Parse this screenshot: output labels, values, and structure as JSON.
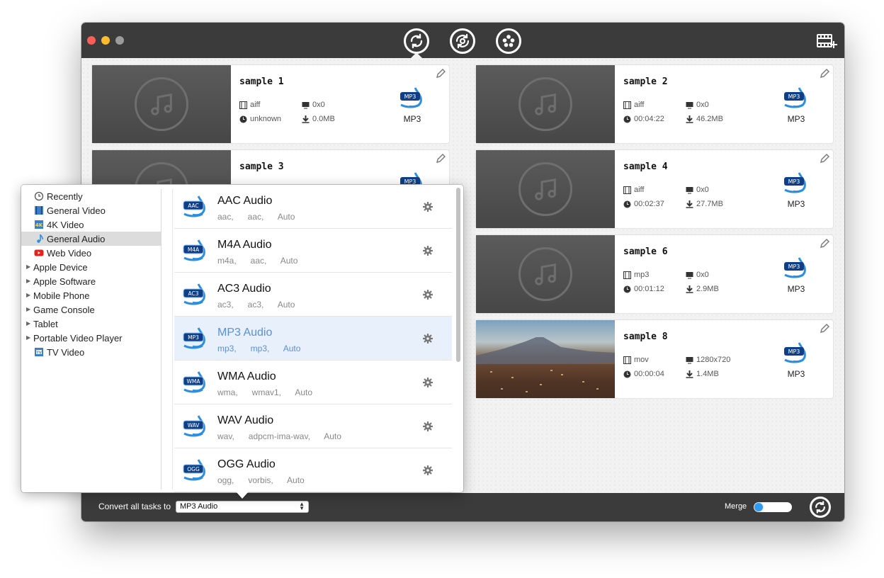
{
  "toolbar": {
    "convert_icon": "convert-icon",
    "rip_icon": "rip-icon",
    "toolbox_icon": "film-reel-icon",
    "add_files_icon": "add-video-icon"
  },
  "cards": [
    {
      "title": "sample 1",
      "format": "aiff",
      "resolution": "0x0",
      "duration": "unknown",
      "size": "0.0MB",
      "output": "MP3"
    },
    {
      "title": "sample 2",
      "format": "aiff",
      "resolution": "0x0",
      "duration": "00:04:22",
      "size": "46.2MB",
      "output": "MP3"
    },
    {
      "title": "sample 3",
      "format": "",
      "resolution": "",
      "duration": "",
      "size": "",
      "output": ""
    },
    {
      "title": "sample 4",
      "format": "aiff",
      "resolution": "0x0",
      "duration": "00:02:37",
      "size": "27.7MB",
      "output": "MP3"
    },
    {
      "title": "sample 6",
      "format": "mp3",
      "resolution": "0x0",
      "duration": "00:01:12",
      "size": "2.9MB",
      "output": "MP3"
    },
    {
      "title": "sample 8",
      "format": "mov",
      "resolution": "1280x720",
      "duration": "00:00:04",
      "size": "1.4MB",
      "output": "MP3"
    }
  ],
  "categories": [
    {
      "label": "Recently",
      "icon": "history-icon"
    },
    {
      "label": "General Video",
      "icon": "film-icon"
    },
    {
      "label": "4K Video",
      "icon": "4k-icon"
    },
    {
      "label": "General Audio",
      "icon": "music-note-icon"
    },
    {
      "label": "Web Video",
      "icon": "youtube-icon"
    },
    {
      "label": "Apple Device"
    },
    {
      "label": "Apple Software"
    },
    {
      "label": "Mobile Phone"
    },
    {
      "label": "Game Console"
    },
    {
      "label": "Tablet"
    },
    {
      "label": "Portable Video Player"
    },
    {
      "label": "TV Video",
      "icon": "tv-icon"
    }
  ],
  "formats": [
    {
      "name": "AAC Audio",
      "badge": "AAC",
      "desc": "aac,      aac,      Auto"
    },
    {
      "name": "M4A Audio",
      "badge": "M4A",
      "desc": "m4a,      aac,      Auto"
    },
    {
      "name": "AC3 Audio",
      "badge": "AC3",
      "desc": "ac3,      ac3,      Auto"
    },
    {
      "name": "MP3 Audio",
      "badge": "MP3",
      "desc": "mp3,      mp3,      Auto"
    },
    {
      "name": "WMA Audio",
      "badge": "WMA",
      "desc": "wma,      wmav1,      Auto"
    },
    {
      "name": "WAV Audio",
      "badge": "WAV",
      "desc": "wav,      adpcm-ima-wav,      Auto"
    },
    {
      "name": "OGG Audio",
      "badge": "OGG",
      "desc": "ogg,      vorbis,      Auto"
    }
  ],
  "bottom": {
    "convert_label": "Convert all tasks to",
    "selected_format": "MP3 Audio",
    "merge_label": "Merge"
  },
  "colors": {
    "accent": "#2d9cf2",
    "titlebar": "#3b3b3b",
    "selected_text": "#5b8fd6"
  }
}
